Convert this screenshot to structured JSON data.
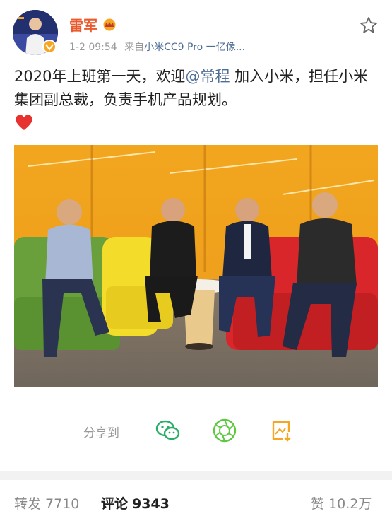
{
  "post": {
    "username": "雷军",
    "time": "1-2 09:54",
    "source_prefix": "来自",
    "source": "小米CC9 Pro 一亿像...",
    "text_before": "2020年上班第一天，欢迎",
    "mention": "@常程",
    "text_after": " 加入小米，担任小米集团副总裁，负责手机产品规划。",
    "emoji": "heart"
  },
  "share": {
    "label": "分享到",
    "targets": [
      "wechat-icon",
      "moments-icon",
      "save-image-icon"
    ]
  },
  "stats": {
    "repost_label": "转发",
    "repost_count": "7710",
    "comment_label": "评论",
    "comment_count": "9343",
    "like_label": "赞",
    "like_count": "10.2万"
  },
  "colors": {
    "username": "#ea5a2c",
    "link": "#4e6e94",
    "wechat_green": "#2aae67",
    "moments_green": "#5fc843",
    "save_orange": "#f5a623"
  }
}
